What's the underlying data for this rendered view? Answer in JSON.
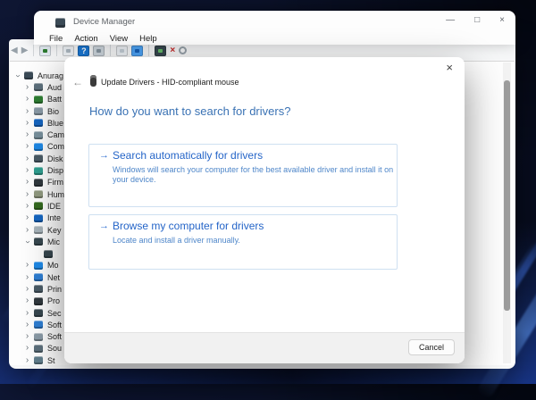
{
  "wallpaper": {
    "base": "#0a1128",
    "glow": "#234bbe",
    "streak": "#5a96ff"
  },
  "device_manager": {
    "title": "Device Manager",
    "window_controls": {
      "minimize": "—",
      "maximize": "□",
      "close": "×"
    },
    "menus": [
      "File",
      "Action",
      "View",
      "Help"
    ],
    "toolbar": [
      {
        "kind": "glyph",
        "name": "back-icon",
        "glyph": "◀",
        "fg": "#97a1a9"
      },
      {
        "kind": "glyph",
        "name": "forward-icon",
        "glyph": "▶",
        "fg": "#97a1a9"
      },
      {
        "kind": "sep",
        "name": "toolbar-separator"
      },
      {
        "kind": "swatch",
        "name": "console-tree-icon",
        "bg": "#e4ecf3",
        "dot": "#2e7d32"
      },
      {
        "kind": "sep",
        "name": "toolbar-separator"
      },
      {
        "kind": "swatch",
        "name": "properties-icon",
        "bg": "#edf1f5",
        "dot": "#aab6bf"
      },
      {
        "kind": "swatch",
        "name": "help-icon",
        "bg": "#1976d2",
        "glyph": "?",
        "fg": "#ffffff"
      },
      {
        "kind": "swatch",
        "name": "list-icon",
        "bg": "#cdd6dd",
        "dot": "#8795a1"
      },
      {
        "kind": "sep",
        "name": "toolbar-separator"
      },
      {
        "kind": "swatch",
        "name": "scan-page-icon",
        "bg": "#edf1f5",
        "dot": "#c3ced6"
      },
      {
        "kind": "swatch",
        "name": "update-driver-screen-icon",
        "bg": "#4da3f5",
        "dot": "#1660b8"
      },
      {
        "kind": "sep",
        "name": "toolbar-separator"
      },
      {
        "kind": "swatch",
        "name": "uninstall-device-icon",
        "bg": "#37474f",
        "dot": "#66bb6a"
      },
      {
        "kind": "glyph",
        "name": "remove-red-x-icon",
        "glyph": "×",
        "fg": "#c62828",
        "bold": true
      },
      {
        "kind": "ring",
        "name": "disable-device-icon",
        "fg": "#97a1a9"
      }
    ],
    "tree": {
      "items": [
        {
          "label": "Anurag",
          "icon": "computer-icon",
          "color": "#3b4a56",
          "chevron": "expanded",
          "depth": 0
        },
        {
          "label": "Aud",
          "icon": "audio-device-icon",
          "color": "#5c6f7b",
          "chevron": "collapsed",
          "depth": 1
        },
        {
          "label": "Batt",
          "icon": "battery-icon",
          "color": "#2e7d32",
          "chevron": "collapsed",
          "depth": 1
        },
        {
          "label": "Bio",
          "icon": "biometric-icon",
          "color": "#8a9aa6",
          "chevron": "collapsed",
          "depth": 1
        },
        {
          "label": "Blue",
          "icon": "bluetooth-icon",
          "color": "#1565c0",
          "chevron": "collapsed",
          "depth": 1
        },
        {
          "label": "Cam",
          "icon": "camera-icon",
          "color": "#78909c",
          "chevron": "collapsed",
          "depth": 1
        },
        {
          "label": "Com",
          "icon": "computer-monitor-icon",
          "color": "#1e88e5",
          "chevron": "collapsed",
          "depth": 1
        },
        {
          "label": "Disk",
          "icon": "disk-drive-icon",
          "color": "#4a5b66",
          "chevron": "collapsed",
          "depth": 1
        },
        {
          "label": "Disp",
          "icon": "display-adapter-icon",
          "color": "#2f9e8f",
          "chevron": "collapsed",
          "depth": 1
        },
        {
          "label": "Firm",
          "icon": "firmware-icon",
          "color": "#30383d",
          "chevron": "collapsed",
          "depth": 1
        },
        {
          "label": "Hum",
          "icon": "hid-device-icon",
          "color": "#90997f",
          "chevron": "collapsed",
          "depth": 1
        },
        {
          "label": "IDE",
          "icon": "ide-controller-icon",
          "color": "#33691e",
          "chevron": "collapsed",
          "depth": 1
        },
        {
          "label": "Inte",
          "icon": "interface-card-icon",
          "color": "#1565c0",
          "chevron": "collapsed",
          "depth": 1
        },
        {
          "label": "Key",
          "icon": "keyboard-icon",
          "color": "#a7b3ba",
          "chevron": "collapsed",
          "depth": 1
        },
        {
          "label": "Mic",
          "icon": "mouse-icon",
          "color": "#37474f",
          "chevron": "expanded",
          "depth": 1
        },
        {
          "label": "",
          "icon": "mouse-icon",
          "color": "#37474f",
          "chevron": "none",
          "depth": 2
        },
        {
          "label": "Mo",
          "icon": "monitor-icon",
          "color": "#1e88e5",
          "chevron": "collapsed",
          "depth": 1
        },
        {
          "label": "Net",
          "icon": "network-adapter-icon",
          "color": "#2e7dd1",
          "chevron": "collapsed",
          "depth": 1
        },
        {
          "label": "Prin",
          "icon": "printer-icon",
          "color": "#4a5b66",
          "chevron": "collapsed",
          "depth": 1
        },
        {
          "label": "Pro",
          "icon": "processor-icon",
          "color": "#30383d",
          "chevron": "collapsed",
          "depth": 1
        },
        {
          "label": "Sec",
          "icon": "security-device-icon",
          "color": "#37474f",
          "chevron": "collapsed",
          "depth": 1
        },
        {
          "label": "Soft",
          "icon": "software-component-icon",
          "color": "#2e7dd1",
          "chevron": "collapsed",
          "depth": 1
        },
        {
          "label": "Soft",
          "icon": "software-device-icon",
          "color": "#8a9aa6",
          "chevron": "collapsed",
          "depth": 1
        },
        {
          "label": "Sou",
          "icon": "sound-controller-icon",
          "color": "#5c6f7b",
          "chevron": "collapsed",
          "depth": 1
        },
        {
          "label": "St",
          "icon": "storage-controller-icon",
          "color": "#607d8b",
          "chevron": "collapsed",
          "depth": 1
        }
      ]
    }
  },
  "dialog": {
    "back_glyph": "←",
    "close_glyph": "×",
    "title": "Update Drivers - HID-compliant mouse",
    "heading": "How do you want to search for drivers?",
    "option_arrow": "→",
    "options": [
      {
        "title": "Search automatically for drivers",
        "description": "Windows will search your computer for the best available driver and install it on your device."
      },
      {
        "title": "Browse my computer for drivers",
        "description": "Locate and install a driver manually."
      }
    ],
    "cancel_label": "Cancel",
    "accent": "#2565c8"
  }
}
